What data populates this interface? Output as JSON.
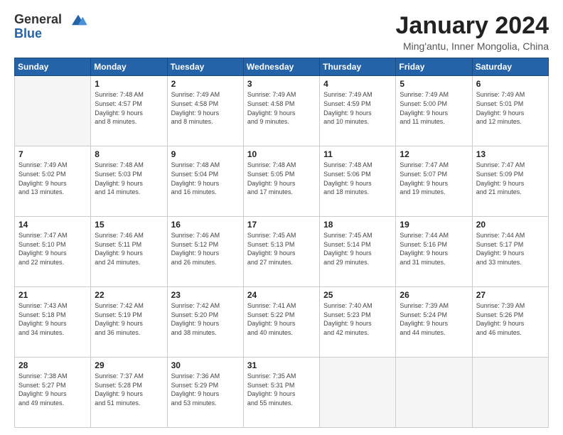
{
  "logo": {
    "general": "General",
    "blue": "Blue"
  },
  "header": {
    "title": "January 2024",
    "subtitle": "Ming'antu, Inner Mongolia, China"
  },
  "days_of_week": [
    "Sunday",
    "Monday",
    "Tuesday",
    "Wednesday",
    "Thursday",
    "Friday",
    "Saturday"
  ],
  "weeks": [
    [
      {
        "day": "",
        "empty": true
      },
      {
        "day": "1",
        "sunrise": "Sunrise: 7:48 AM",
        "sunset": "Sunset: 4:57 PM",
        "daylight": "Daylight: 9 hours and 8 minutes."
      },
      {
        "day": "2",
        "sunrise": "Sunrise: 7:49 AM",
        "sunset": "Sunset: 4:58 PM",
        "daylight": "Daylight: 9 hours and 8 minutes."
      },
      {
        "day": "3",
        "sunrise": "Sunrise: 7:49 AM",
        "sunset": "Sunset: 4:58 PM",
        "daylight": "Daylight: 9 hours and 9 minutes."
      },
      {
        "day": "4",
        "sunrise": "Sunrise: 7:49 AM",
        "sunset": "Sunset: 4:59 PM",
        "daylight": "Daylight: 9 hours and 10 minutes."
      },
      {
        "day": "5",
        "sunrise": "Sunrise: 7:49 AM",
        "sunset": "Sunset: 5:00 PM",
        "daylight": "Daylight: 9 hours and 11 minutes."
      },
      {
        "day": "6",
        "sunrise": "Sunrise: 7:49 AM",
        "sunset": "Sunset: 5:01 PM",
        "daylight": "Daylight: 9 hours and 12 minutes."
      }
    ],
    [
      {
        "day": "7",
        "sunrise": "Sunrise: 7:49 AM",
        "sunset": "Sunset: 5:02 PM",
        "daylight": "Daylight: 9 hours and 13 minutes."
      },
      {
        "day": "8",
        "sunrise": "Sunrise: 7:48 AM",
        "sunset": "Sunset: 5:03 PM",
        "daylight": "Daylight: 9 hours and 14 minutes."
      },
      {
        "day": "9",
        "sunrise": "Sunrise: 7:48 AM",
        "sunset": "Sunset: 5:04 PM",
        "daylight": "Daylight: 9 hours and 16 minutes."
      },
      {
        "day": "10",
        "sunrise": "Sunrise: 7:48 AM",
        "sunset": "Sunset: 5:05 PM",
        "daylight": "Daylight: 9 hours and 17 minutes."
      },
      {
        "day": "11",
        "sunrise": "Sunrise: 7:48 AM",
        "sunset": "Sunset: 5:06 PM",
        "daylight": "Daylight: 9 hours and 18 minutes."
      },
      {
        "day": "12",
        "sunrise": "Sunrise: 7:47 AM",
        "sunset": "Sunset: 5:07 PM",
        "daylight": "Daylight: 9 hours and 19 minutes."
      },
      {
        "day": "13",
        "sunrise": "Sunrise: 7:47 AM",
        "sunset": "Sunset: 5:09 PM",
        "daylight": "Daylight: 9 hours and 21 minutes."
      }
    ],
    [
      {
        "day": "14",
        "sunrise": "Sunrise: 7:47 AM",
        "sunset": "Sunset: 5:10 PM",
        "daylight": "Daylight: 9 hours and 22 minutes."
      },
      {
        "day": "15",
        "sunrise": "Sunrise: 7:46 AM",
        "sunset": "Sunset: 5:11 PM",
        "daylight": "Daylight: 9 hours and 24 minutes."
      },
      {
        "day": "16",
        "sunrise": "Sunrise: 7:46 AM",
        "sunset": "Sunset: 5:12 PM",
        "daylight": "Daylight: 9 hours and 26 minutes."
      },
      {
        "day": "17",
        "sunrise": "Sunrise: 7:45 AM",
        "sunset": "Sunset: 5:13 PM",
        "daylight": "Daylight: 9 hours and 27 minutes."
      },
      {
        "day": "18",
        "sunrise": "Sunrise: 7:45 AM",
        "sunset": "Sunset: 5:14 PM",
        "daylight": "Daylight: 9 hours and 29 minutes."
      },
      {
        "day": "19",
        "sunrise": "Sunrise: 7:44 AM",
        "sunset": "Sunset: 5:16 PM",
        "daylight": "Daylight: 9 hours and 31 minutes."
      },
      {
        "day": "20",
        "sunrise": "Sunrise: 7:44 AM",
        "sunset": "Sunset: 5:17 PM",
        "daylight": "Daylight: 9 hours and 33 minutes."
      }
    ],
    [
      {
        "day": "21",
        "sunrise": "Sunrise: 7:43 AM",
        "sunset": "Sunset: 5:18 PM",
        "daylight": "Daylight: 9 hours and 34 minutes."
      },
      {
        "day": "22",
        "sunrise": "Sunrise: 7:42 AM",
        "sunset": "Sunset: 5:19 PM",
        "daylight": "Daylight: 9 hours and 36 minutes."
      },
      {
        "day": "23",
        "sunrise": "Sunrise: 7:42 AM",
        "sunset": "Sunset: 5:20 PM",
        "daylight": "Daylight: 9 hours and 38 minutes."
      },
      {
        "day": "24",
        "sunrise": "Sunrise: 7:41 AM",
        "sunset": "Sunset: 5:22 PM",
        "daylight": "Daylight: 9 hours and 40 minutes."
      },
      {
        "day": "25",
        "sunrise": "Sunrise: 7:40 AM",
        "sunset": "Sunset: 5:23 PM",
        "daylight": "Daylight: 9 hours and 42 minutes."
      },
      {
        "day": "26",
        "sunrise": "Sunrise: 7:39 AM",
        "sunset": "Sunset: 5:24 PM",
        "daylight": "Daylight: 9 hours and 44 minutes."
      },
      {
        "day": "27",
        "sunrise": "Sunrise: 7:39 AM",
        "sunset": "Sunset: 5:26 PM",
        "daylight": "Daylight: 9 hours and 46 minutes."
      }
    ],
    [
      {
        "day": "28",
        "sunrise": "Sunrise: 7:38 AM",
        "sunset": "Sunset: 5:27 PM",
        "daylight": "Daylight: 9 hours and 49 minutes."
      },
      {
        "day": "29",
        "sunrise": "Sunrise: 7:37 AM",
        "sunset": "Sunset: 5:28 PM",
        "daylight": "Daylight: 9 hours and 51 minutes."
      },
      {
        "day": "30",
        "sunrise": "Sunrise: 7:36 AM",
        "sunset": "Sunset: 5:29 PM",
        "daylight": "Daylight: 9 hours and 53 minutes."
      },
      {
        "day": "31",
        "sunrise": "Sunrise: 7:35 AM",
        "sunset": "Sunset: 5:31 PM",
        "daylight": "Daylight: 9 hours and 55 minutes."
      },
      {
        "day": "",
        "empty": true
      },
      {
        "day": "",
        "empty": true
      },
      {
        "day": "",
        "empty": true
      }
    ]
  ]
}
